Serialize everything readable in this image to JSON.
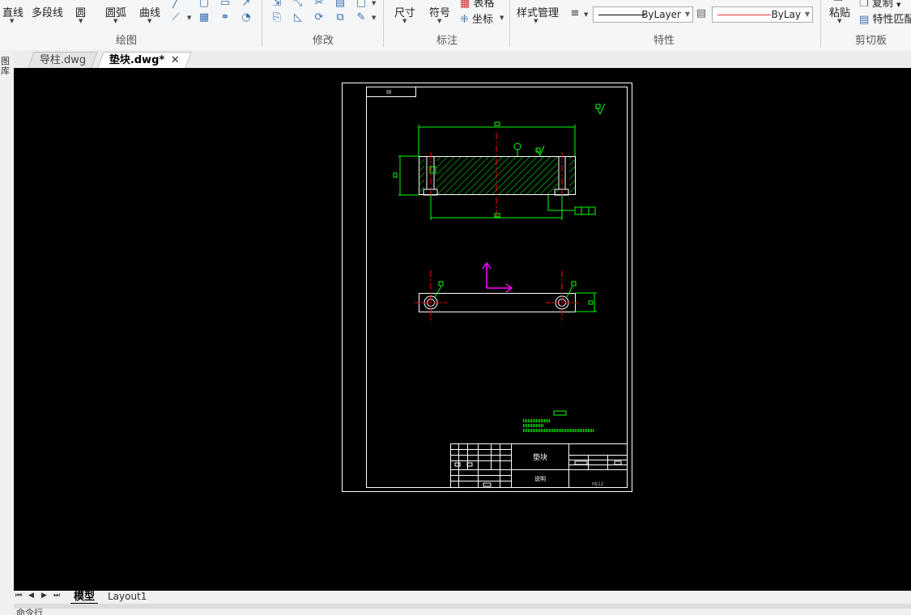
{
  "ribbon": {
    "draw": {
      "line_label": "直线",
      "polyline_label": "多段线",
      "circle_label": "圆",
      "arc_label": "圆弧",
      "curve_label": "曲线",
      "group_title": "绘图"
    },
    "modify": {
      "group_title": "修改"
    },
    "annotation": {
      "dimension_label": "尺寸",
      "symbol_label": "符号",
      "table_label": "表格",
      "coordinate_label": "坐标",
      "group_title": "标注"
    },
    "properties": {
      "style_manager_label": "样式管理",
      "linetype_value": "ByLayer",
      "color_value": "ByLay",
      "group_title": "特性"
    },
    "clipboard": {
      "paste_label": "粘贴",
      "copy_label": "复制",
      "match_label": "特性匹配",
      "group_title": "剪切板"
    }
  },
  "doc_tabs": [
    {
      "label": "导柱.dwg",
      "active": false
    },
    {
      "label": "垫块.dwg*",
      "active": true
    }
  ],
  "side_strip_label": "图库",
  "drawing": {
    "title_block_name": "垫块",
    "title_block_sub": "说明",
    "title_block_code": "MJ12"
  },
  "layout_tabs": [
    {
      "label": "模型",
      "active": true
    },
    {
      "label": "Layout1",
      "active": false
    }
  ],
  "command_line_label": "命令行",
  "colors": {
    "canvas": "#000000",
    "frame": "#ffffff",
    "geometry": "#00ff00",
    "centerline": "#ff0000",
    "ucs": "#ff00ff"
  }
}
